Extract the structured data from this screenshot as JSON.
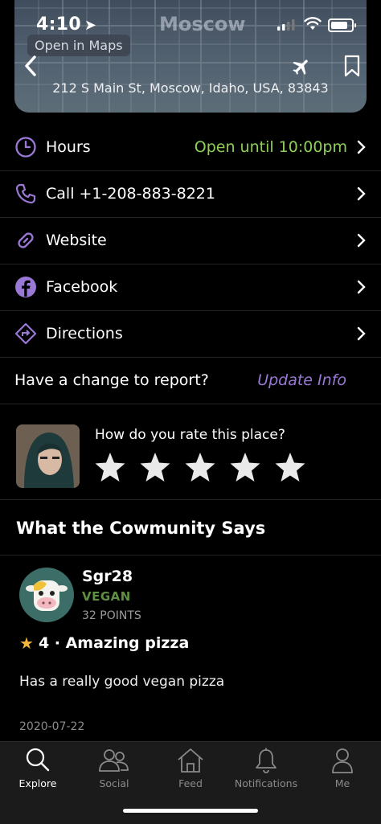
{
  "status": {
    "time": "4:10"
  },
  "map": {
    "city_label": "Moscow",
    "open_in_maps": "Open in Maps",
    "address": "212 S Main St, Moscow, Idaho, USA, 83843"
  },
  "info_rows": {
    "hours_label": "Hours",
    "hours_value": "Open until 10:00pm",
    "call_label": "Call +1-208-883-8221",
    "website_label": "Website",
    "facebook_label": "Facebook",
    "directions_label": "Directions"
  },
  "report": {
    "question": "Have a change to report?",
    "action": "Update Info"
  },
  "rating": {
    "question": "How do you rate this place?",
    "stars_max": 5
  },
  "community": {
    "title": "What the Cowmunity Says"
  },
  "review": {
    "username": "Sgr28",
    "diet": "VEGAN",
    "points": "32 POINTS",
    "headline": "4 · Amazing pizza",
    "rating": 4,
    "body": "Has a really good vegan pizza",
    "date": "2020-07-22"
  },
  "tabs": {
    "explore": "Explore",
    "social": "Social",
    "feed": "Feed",
    "notifications": "Notifications",
    "me": "Me"
  },
  "colors": {
    "accent_purple": "#9a78d6",
    "open_green": "#8fcf57",
    "diet_green": "#5e8f43",
    "star_gold": "#f4b53a"
  }
}
